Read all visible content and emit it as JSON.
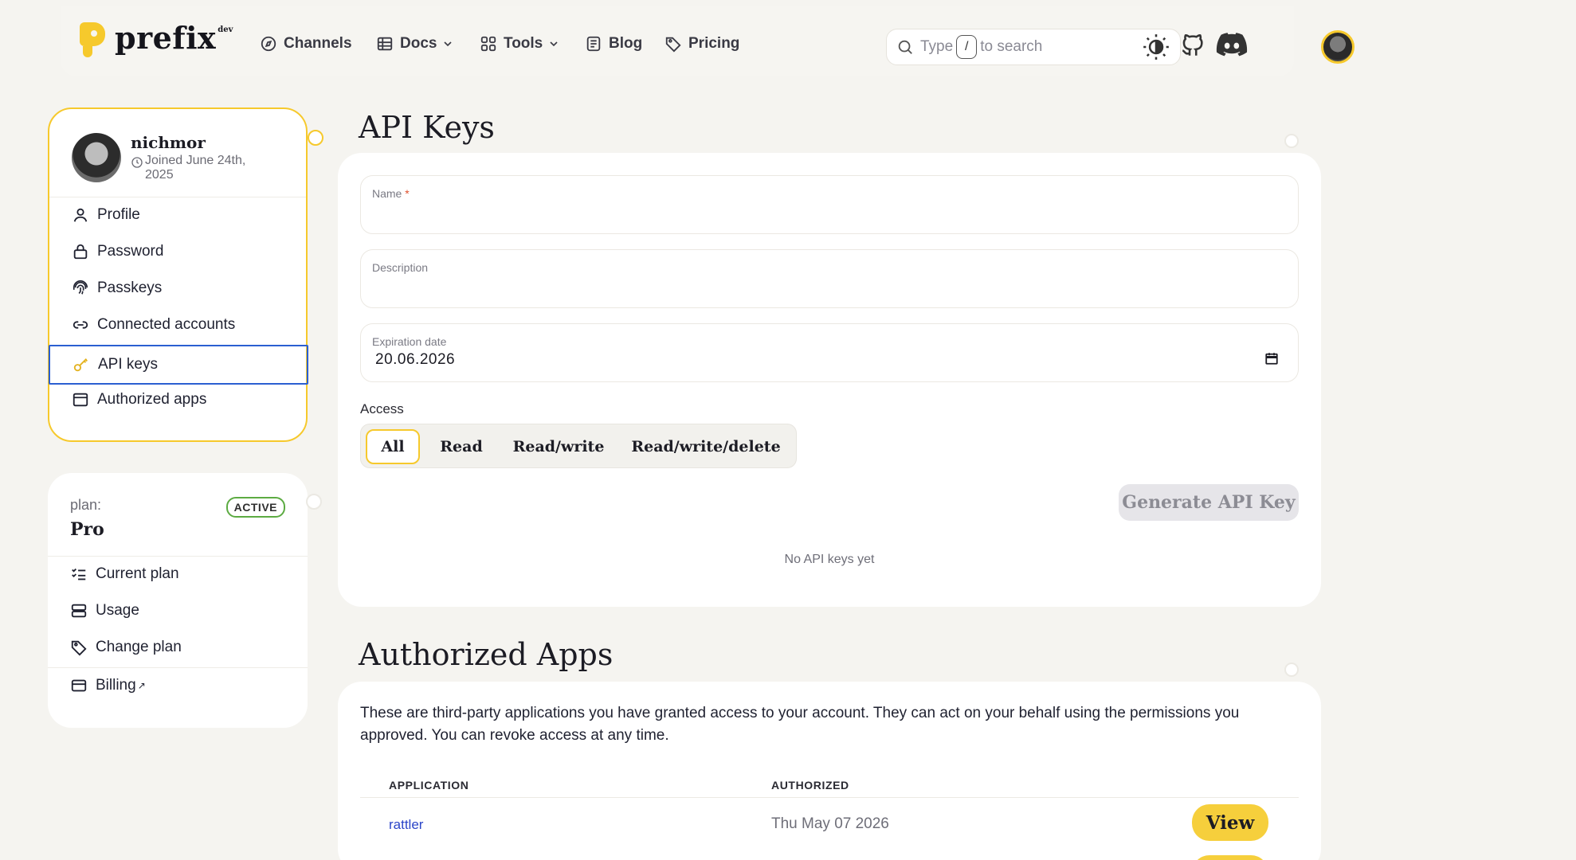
{
  "brand": {
    "name": "prefix",
    "sup": "dev"
  },
  "nav": {
    "channels": "Channels",
    "docs": "Docs",
    "tools": "Tools",
    "blog": "Blog",
    "pricing": "Pricing"
  },
  "search": {
    "prefix": "Type",
    "key": "/",
    "suffix": "to search"
  },
  "user": {
    "name": "nichmor",
    "joined": "Joined June 24th, 2025"
  },
  "sidebar": {
    "items": [
      {
        "label": "Profile",
        "icon": "user-icon"
      },
      {
        "label": "Password",
        "icon": "lock-icon"
      },
      {
        "label": "Passkeys",
        "icon": "fingerprint-icon"
      },
      {
        "label": "Connected accounts",
        "icon": "link-icon"
      },
      {
        "label": "API keys",
        "icon": "key-icon"
      },
      {
        "label": "Authorized apps",
        "icon": "window-icon"
      }
    ],
    "active": "API keys"
  },
  "plan": {
    "label": "plan:",
    "name": "Pro",
    "status": "ACTIVE",
    "items": [
      {
        "label": "Current plan",
        "icon": "checklist-icon"
      },
      {
        "label": "Usage",
        "icon": "server-icon"
      },
      {
        "label": "Change plan",
        "icon": "tag-icon"
      },
      {
        "label": "Billing",
        "icon": "card-icon",
        "external": "↗"
      }
    ]
  },
  "api_keys": {
    "title": "API Keys",
    "name_label": "Name",
    "name_required": "*",
    "name_value": "",
    "description_label": "Description",
    "description_value": "",
    "expiration_label": "Expiration date",
    "expiration_value": "20.06.2026",
    "access_label": "Access",
    "access_options": [
      "All",
      "Read",
      "Read/write",
      "Read/write/delete"
    ],
    "access_selected": "All",
    "generate_label": "Generate API Key",
    "empty_message": "No API keys yet"
  },
  "authorized_apps": {
    "title": "Authorized Apps",
    "description": "These are third-party applications you have granted access to your account. They can act on your behalf using the permissions you approved. You can revoke access at any time.",
    "columns": [
      "APPLICATION",
      "AUTHORIZED"
    ],
    "rows": [
      {
        "application": "rattler",
        "authorized": "Thu May 07 2026",
        "action": "View"
      }
    ]
  },
  "colors": {
    "accent": "#f6c92c",
    "active_border": "#2b5fd1",
    "status_green": "#5cab42",
    "link": "#2b45c8"
  }
}
